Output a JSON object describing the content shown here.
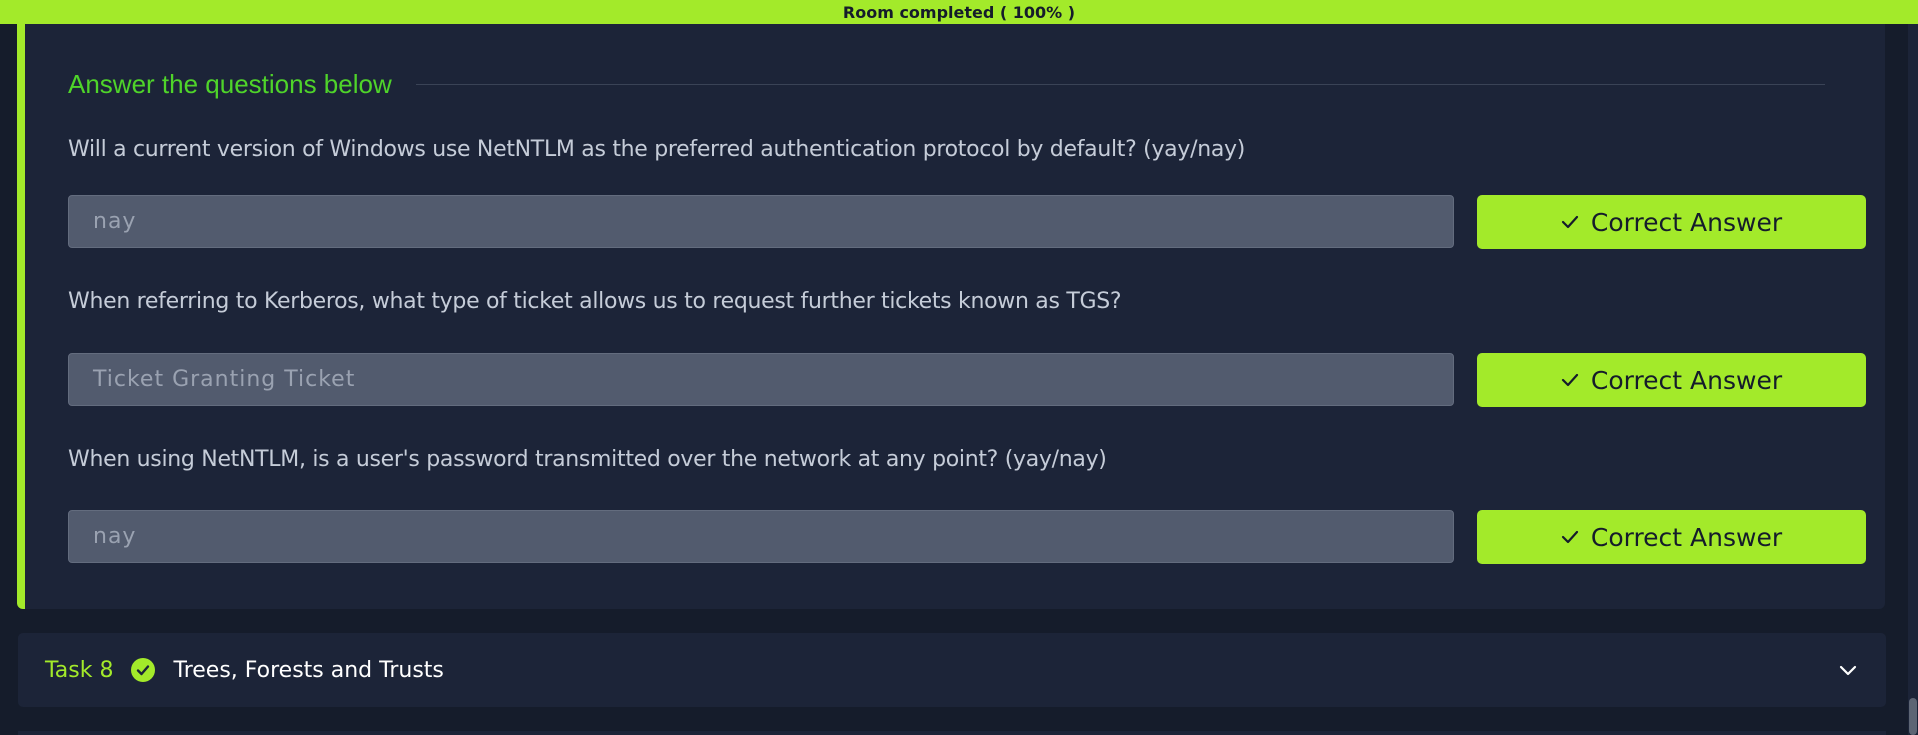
{
  "progress": {
    "text": "Room completed ( 100% )",
    "percent": 100
  },
  "qa": {
    "header": "Answer the questions below",
    "questions": [
      {
        "text": "Will a current version of Windows use NetNTLM as the preferred authentication protocol by default? (yay/nay)",
        "answer": "nay",
        "button": "Correct Answer"
      },
      {
        "text": "When referring to Kerberos, what type of ticket allows us to request further tickets known as TGS?",
        "answer": "Ticket Granting Ticket",
        "button": "Correct Answer"
      },
      {
        "text": "When using NetNTLM, is a user's password transmitted over the network at any point? (yay/nay)",
        "answer": "nay",
        "button": "Correct Answer"
      }
    ]
  },
  "next_task": {
    "number": "Task 8",
    "title": "Trees, Forests and Trusts",
    "status_icon": "check-circle-icon",
    "expand_icon": "chevron-down-icon"
  },
  "colors": {
    "accent": "#a3ea2a",
    "heading_green": "#4fd42a",
    "panel_bg": "#1c2438",
    "page_bg": "#151c2b",
    "input_bg": "#525b6e"
  }
}
